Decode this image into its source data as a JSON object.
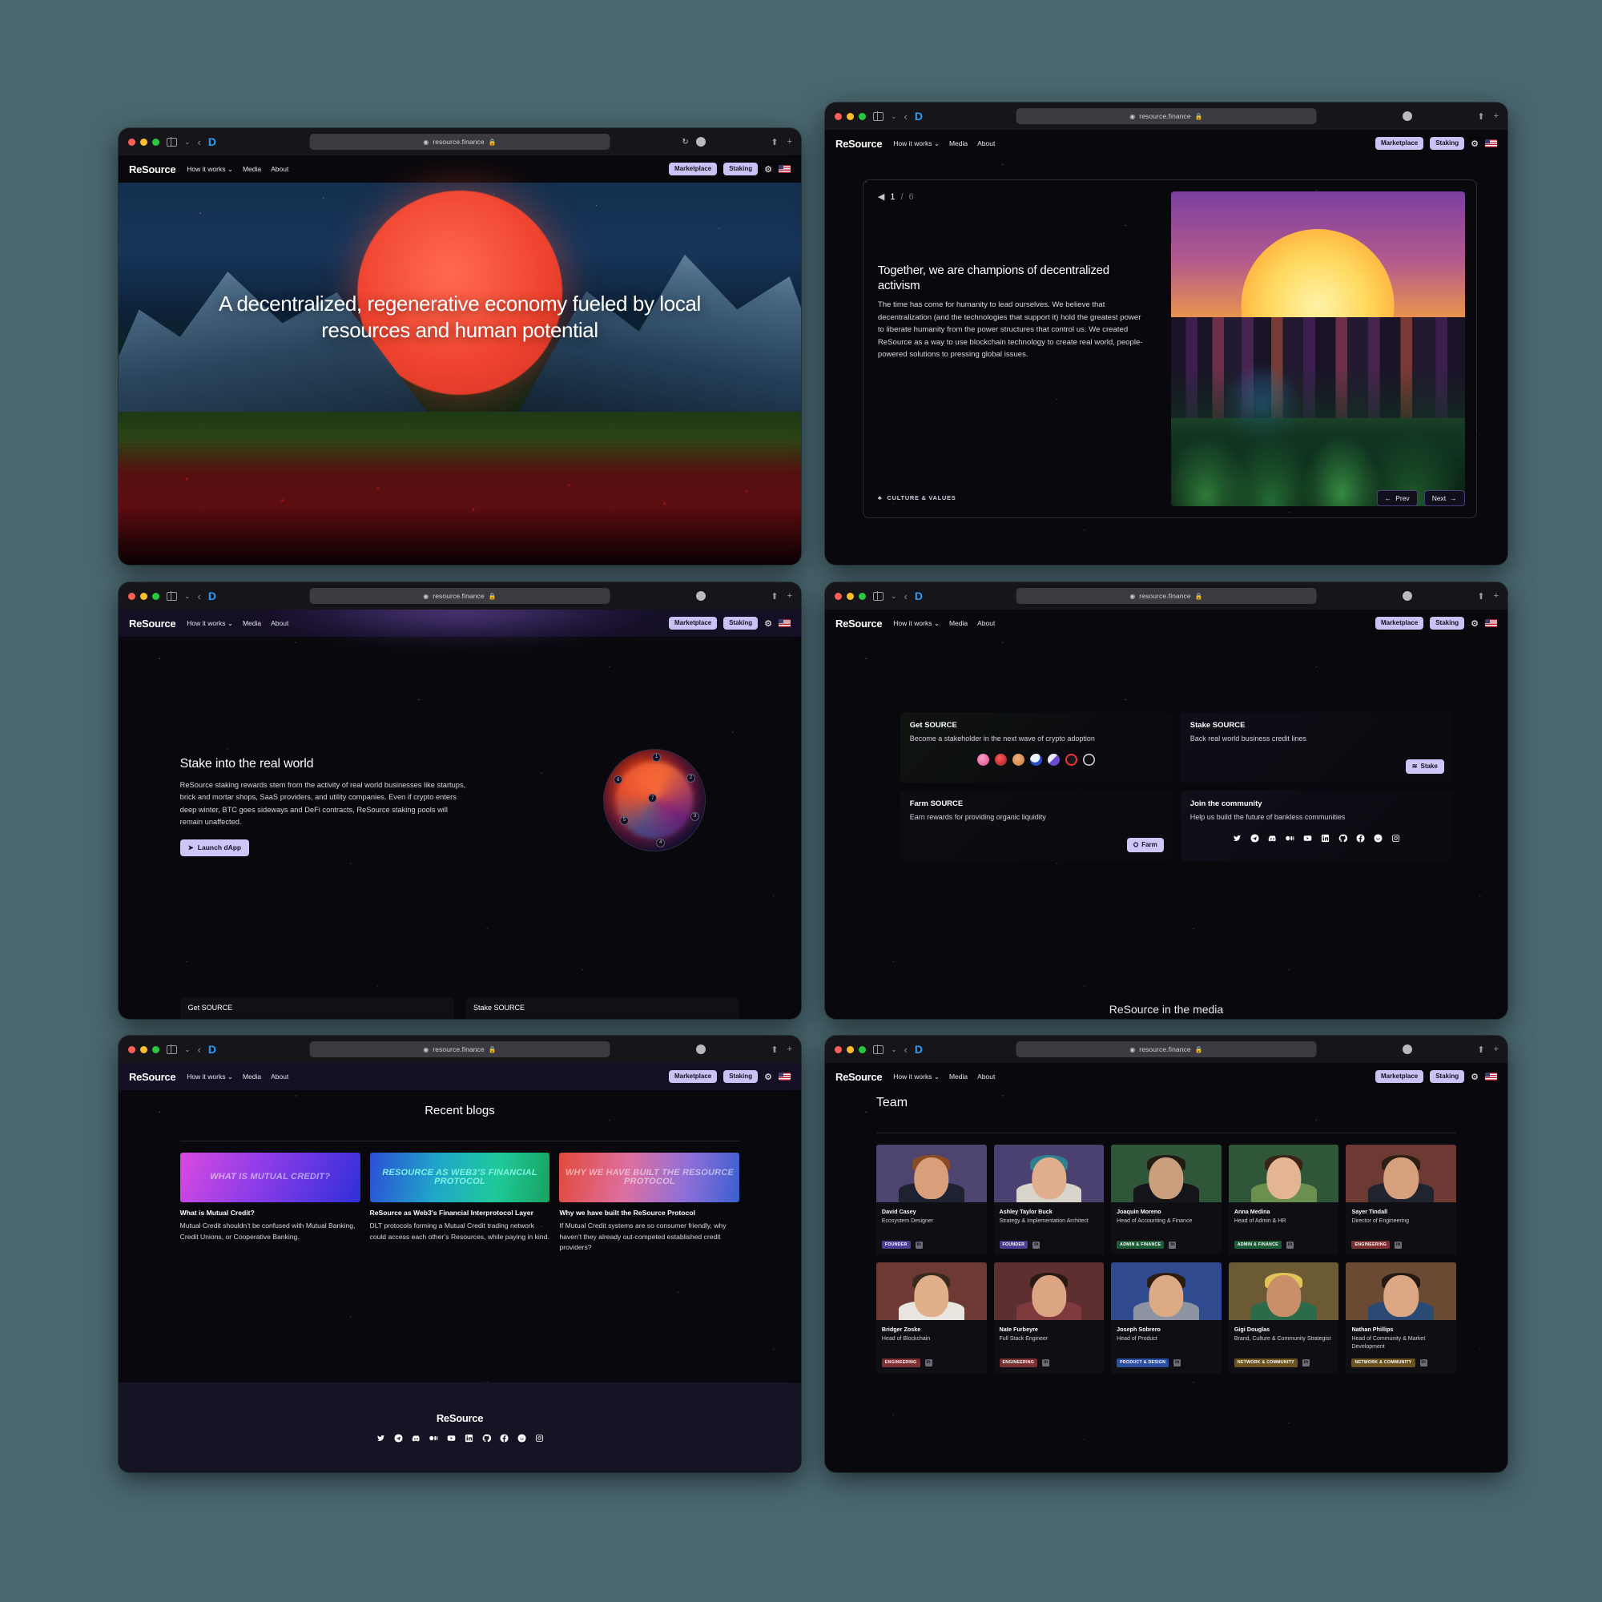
{
  "browser": {
    "url": "resource.finance",
    "lock_glyph": "🔒",
    "shield_glyph": "D",
    "back_glyph": "‹",
    "chev_glyph": "⌄",
    "reload_glyph": "↻",
    "share_glyph": "⬆",
    "newtab_glyph": "+"
  },
  "nav": {
    "brand": "ReSource",
    "links": [
      "How it works",
      "Media",
      "About"
    ],
    "chevron": "⌄",
    "marketplace": "Marketplace",
    "staking": "Staking",
    "gear": "⚙",
    "flag_alt": "us-flag"
  },
  "panel1": {
    "hero_title": "A decentralized, regenerative economy fueled by local resources and human potential"
  },
  "panel2": {
    "counter_icon": "◀",
    "current": "1",
    "separator": "/",
    "total": "6",
    "heading": "Together, we are champions of decentralized activism",
    "paragraph": "The time has come for humanity to lead ourselves. We believe that decentralization (and the technologies that support it) hold the greatest power to liberate humanity from the power structures that control us. We created ReSource as a way to use blockchain technology to create real world, people-powered solutions to pressing global issues.",
    "tag_icon": "♣",
    "tag": "CULTURE & VALUES",
    "prev": "Prev",
    "prev_arrow": "←",
    "next": "Next",
    "next_arrow": "→"
  },
  "panel3": {
    "heading": "Stake into the real world",
    "paragraph": "ReSource staking rewards stem from the activity of real world businesses like startups, brick and mortar shops, SaaS providers, and utility companies. Even if crypto enters deep winter, BTC goes sideways and DeFi contracts, ReSource staking pools will remain unaffected.",
    "cta_icon": "➤",
    "cta": "Launch dApp",
    "orb_nodes": [
      "1",
      "2",
      "3",
      "4",
      "5",
      "6",
      "7"
    ],
    "peek_cards": [
      "Get SOURCE",
      "Stake SOURCE"
    ]
  },
  "panel4": {
    "cards": [
      {
        "title": "Get SOURCE",
        "body": "Become a stakeholder in the next wave of crypto adoption",
        "tokens": [
          "uniswap-icon",
          "sushiswap-icon",
          "pancakeswap-icon",
          "balancer-icon",
          "paintswap-icon",
          "gnosis-icon",
          "metamask-icon"
        ]
      },
      {
        "title": "Stake SOURCE",
        "body": "Back real world business credit lines",
        "button": "Stake",
        "button_icon": "coins-icon"
      },
      {
        "title": "Farm SOURCE",
        "body": "Earn rewards for providing organic liquidity",
        "button": "Farm",
        "button_icon": "tractor-icon"
      },
      {
        "title": "Join the community",
        "body": "Help us build the future of bankless communities",
        "socials": [
          "twitter-icon",
          "telegram-icon",
          "discord-icon",
          "medium-icon",
          "youtube-icon",
          "linkedin-icon",
          "github-icon",
          "facebook-icon",
          "reddit-icon",
          "instagram-icon"
        ]
      }
    ],
    "next_section": "ReSource in the media"
  },
  "panel5": {
    "heading": "Recent blogs",
    "blogs": [
      {
        "cover_text": "WHAT IS MUTUAL CREDIT?",
        "title": "What is Mutual Credit?",
        "excerpt": "Mutual Credit shouldn’t be confused with Mutual Banking, Credit Unions, or Cooperative Banking."
      },
      {
        "cover_text": "RESOURCE AS WEB3’s FINANCIAL PROTOCOL",
        "title": "ReSource as Web3's Financial Interprotocol Layer",
        "excerpt": "DLT protocols forming a Mutual Credit trading network could access each other’s Resources, while paying in kind."
      },
      {
        "cover_text": "WHY WE HAVE BUILT THE RESOURCE PROTOCOL",
        "title": "Why we have built the ReSource Protocol",
        "excerpt": "If Mutual Credit systems are so consumer friendly, why haven’t they already out-competed established credit providers?"
      }
    ],
    "footer_brand": "ReSource",
    "footer_socials": [
      "twitter-icon",
      "telegram-icon",
      "discord-icon",
      "medium-icon",
      "youtube-icon",
      "linkedin-icon",
      "github-icon",
      "facebook-icon",
      "reddit-icon",
      "instagram-icon"
    ]
  },
  "panel6": {
    "heading": "Team",
    "members": [
      {
        "name": "David Casey",
        "role": "Ecosystem Designer",
        "badge": "FOUNDER",
        "badge_class": "b-founder",
        "bg": "#4e4470",
        "skin": "#d8a07a",
        "hair": "#8a4a22",
        "shirt": "#1e2230",
        "link": "linkedin-icon"
      },
      {
        "name": "Ashley Taylor Buck",
        "role": "Strategy & Implementation Architect",
        "badge": "FOUNDER",
        "badge_class": "b-founder",
        "bg": "#4a4170",
        "skin": "#e0ae8c",
        "hair": "#2f7f8e",
        "shirt": "#d8d4cc",
        "link": "linkedin-icon"
      },
      {
        "name": "Joaquin Moreno",
        "role": "Head of Accounting & Finance",
        "badge": "ADMIN & FINANCE",
        "badge_class": "b-admin",
        "bg": "#2f5638",
        "skin": "#caa07c",
        "hair": "#231a14",
        "shirt": "#15151a",
        "link": "linkedin-icon"
      },
      {
        "name": "Anna Medina",
        "role": "Head of Admin & HR",
        "badge": "ADMIN & FINANCE",
        "badge_class": "b-admin",
        "bg": "#2f5638",
        "skin": "#e3b592",
        "hair": "#3a2416",
        "shirt": "#6a8f4e",
        "link": "linkedin-icon"
      },
      {
        "name": "Sayer Tindall",
        "role": "Director of Engineering",
        "badge": "ENGINEERING",
        "badge_class": "b-eng",
        "bg": "#6d3a33",
        "skin": "#d7a07c",
        "hair": "#2b1d14",
        "shirt": "#20242e",
        "link": "linkedin-icon"
      },
      {
        "name": "Bridger Zoske",
        "role": "Head of Blockchain",
        "badge": "ENGINEERING",
        "badge_class": "b-eng",
        "bg": "#6d3a33",
        "skin": "#e0b08a",
        "hair": "#3a2a1c",
        "shirt": "#e8e5de",
        "link": "linkedin-icon"
      },
      {
        "name": "Nate Furbeyre",
        "role": "Full Stack Engineer",
        "badge": "ENGINEERING",
        "badge_class": "b-eng",
        "bg": "#5e2f30",
        "skin": "#dba482",
        "hair": "#2a1a12",
        "shirt": "#7e3a3c",
        "link": "linkedin-icon"
      },
      {
        "name": "Joseph Sobrero",
        "role": "Head of Product",
        "badge": "PRODUCT & DESIGN",
        "badge_class": "b-prod",
        "bg": "#2f4a8e",
        "skin": "#dcab86",
        "hair": "#2c1d13",
        "shirt": "#8d93a0",
        "link": "linkedin-icon"
      },
      {
        "name": "Gigi Douglas",
        "role": "Brand, Culture & Community Strategist",
        "badge": "NETWORK & COMMUNITY",
        "badge_class": "b-net",
        "bg": "#6b5a33",
        "skin": "#c98f68",
        "hair": "#e0c35a",
        "shirt": "#2c6b4a",
        "link": "linkedin-icon"
      },
      {
        "name": "Nathan Phillips",
        "role": "Head of Community & Market Development",
        "badge": "NETWORK & COMMUNITY",
        "badge_class": "b-net",
        "bg": "#6b4a33",
        "skin": "#dca784",
        "hair": "#251a12",
        "shirt": "#2a4a74",
        "link": "linkedin-icon"
      }
    ]
  }
}
